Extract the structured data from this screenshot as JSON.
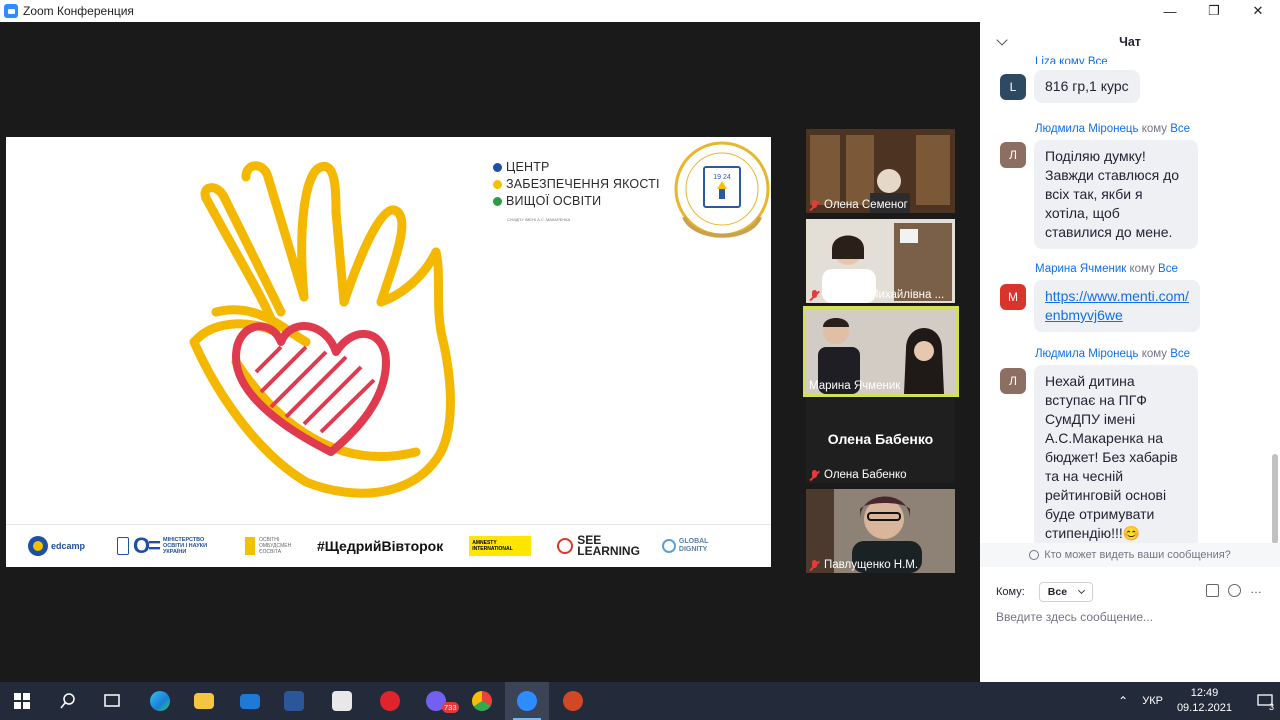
{
  "window": {
    "title": "Zoom Конференция"
  },
  "slide": {
    "center_lines": [
      "ЦЕНТР",
      "ЗАБЕЗПЕЧЕННЯ ЯКОСТІ",
      "ВИЩОЇ ОСВІТИ"
    ],
    "center_dot_colors": [
      "#1f4fa0",
      "#f2c100",
      "#2e9a47"
    ],
    "center_sub": "СУМДПУ ІМЕНІ А.С. МАКАРЕНКА",
    "emblem_year": "19 24",
    "logos": {
      "edcamp": "edcamp",
      "mon": "МІНІСТЕРСТВО ОСВІТИ І НАУКИ УКРАЇНИ",
      "oo": "ОСВІТНІ ОМБУДСМЕН ЄОСВІТА",
      "hashtag": "#ЩедрийВівторок",
      "amnesty": "AMNESTY INTERNATIONAL",
      "see_line1": "SEE",
      "see_line2": "LEARNING",
      "gd_line1": "GLOBAL",
      "gd_line2": "DIGNITY"
    },
    "accent": {
      "hand": "#f5b800",
      "heart": "#e03a4f"
    }
  },
  "gallery": {
    "tiles": [
      {
        "name": "Олена Семеног"
      },
      {
        "name": "Марина Михайлівна ..."
      },
      {
        "name": "Марина Ячменик"
      },
      {
        "name": "Олена Бабенко",
        "big": "Олена Бабенко"
      },
      {
        "name": "Павлущенко Н.М."
      }
    ]
  },
  "chat": {
    "title": "Чат",
    "partial_meta": "Liza кому Все",
    "messages": [
      {
        "avatar": "L",
        "avatar_color": "#2d4a62",
        "text": "816 гр,1 курс"
      },
      {
        "sender": "Людмила Міронець",
        "to_word": "кому",
        "to": "Все",
        "avatar": "Л",
        "avatar_color": "#8d6e63",
        "text": "Поділяю думку! Завжди ставлюся до всіх так, якби я хотіла, щоб ставилися до мене."
      },
      {
        "sender": "Марина Ячменик",
        "to_word": "кому",
        "to": "Все",
        "avatar": "М",
        "avatar_color": "#d9342b",
        "link": "https://www.menti.com/enbmyvj6we"
      },
      {
        "sender": "Людмила Міронець",
        "to_word": "кому",
        "to": "Все",
        "avatar": "Л",
        "avatar_color": "#8d6e63",
        "text": "Нехай дитина вступає на ПГФ СумДПУ імені А.С.Макаренка на бюджет! Без хабарів та на чесній рейтинговій основі буде отримувати стипендію!!!😊"
      }
    ],
    "who_can_see": "Кто может видеть ваши сообщения?",
    "to_label": "Кому:",
    "to_value": "Все",
    "placeholder": "Введите здесь сообщение..."
  },
  "taskbar": {
    "lang": "УКР",
    "time": "12:49",
    "date": "09.12.2021",
    "viber_badge": "733",
    "notif_count": "3"
  }
}
